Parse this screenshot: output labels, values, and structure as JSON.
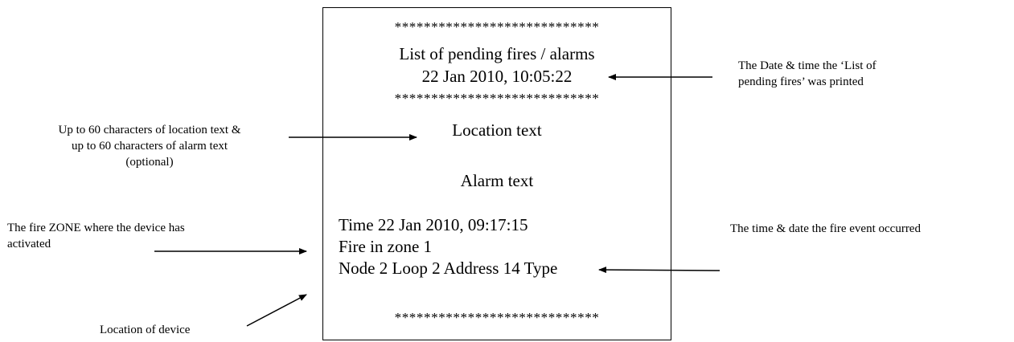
{
  "printout": {
    "separator": "****************************",
    "heading_line1": "List of pending fires / alarms",
    "heading_line2": "22 Jan 2010, 10:05:22",
    "location_text": "Location text",
    "alarm_text": "Alarm text",
    "event_time": "Time 22 Jan 2010, 09:17:15",
    "fire_zone": "Fire in zone 1",
    "device_location": "Node 2 Loop 2  Address 14  Type"
  },
  "annotations": {
    "date_time_printed": {
      "line1": "The Date & time the ‘List of",
      "line2": "pending fires’ was printed"
    },
    "text_chars": {
      "line1": "Up to 60 characters of location text &",
      "line2": "up to 60 characters of alarm text",
      "line3": "(optional)"
    },
    "fire_zone_note": {
      "line1": "The fire ZONE where the device has",
      "line2": "activated"
    },
    "event_time_note": {
      "line1": "The time & date the fire event occurred"
    },
    "device_location_note": {
      "line1": "Location of device"
    }
  }
}
